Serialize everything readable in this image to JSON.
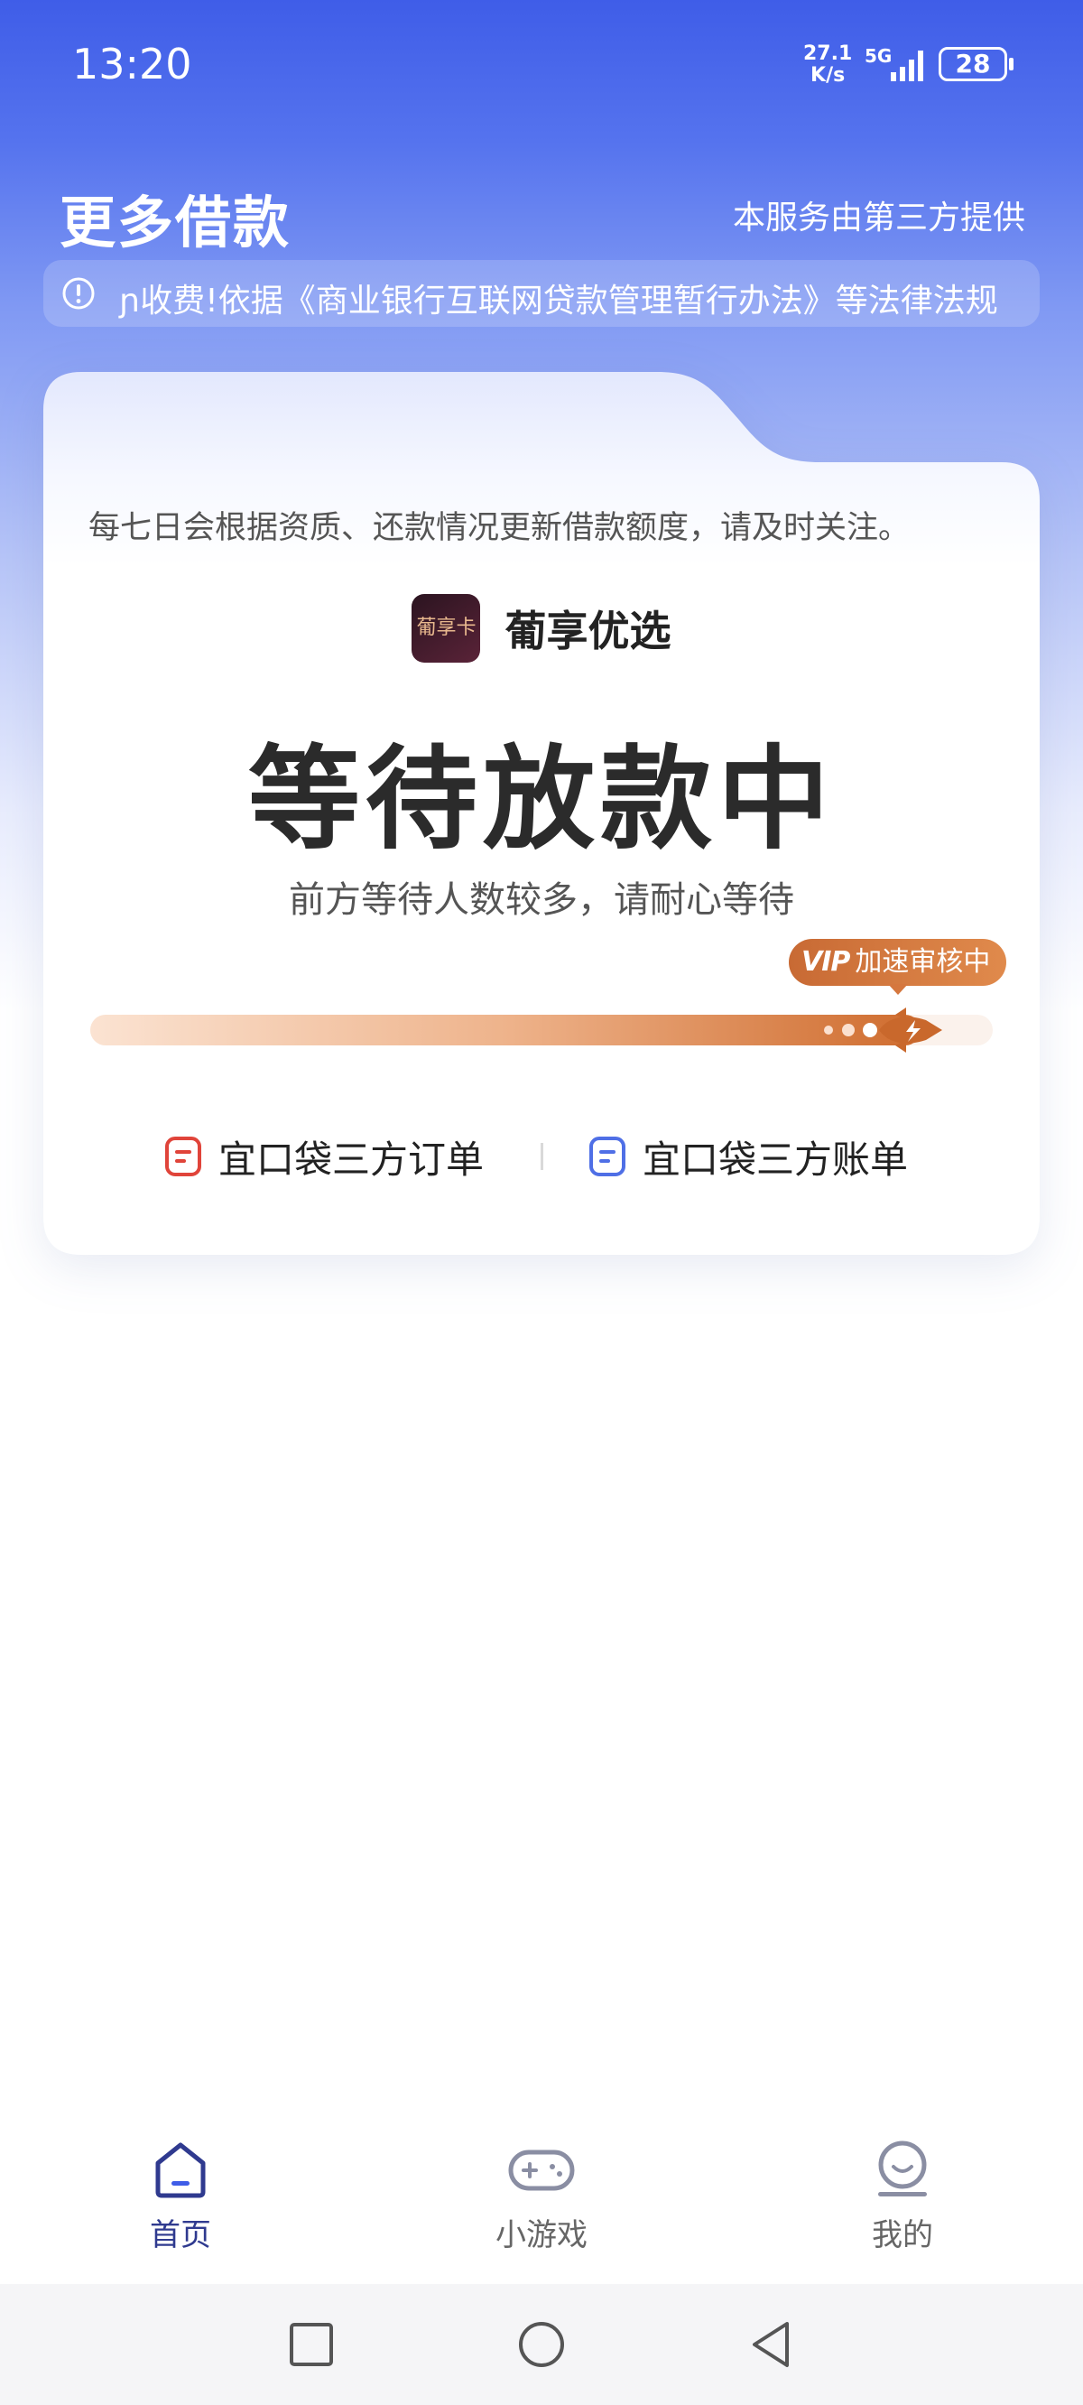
{
  "status_bar": {
    "time": "13:20",
    "net_speed_value": "27.1",
    "net_speed_unit": "K/s",
    "network": "5G",
    "battery": "28"
  },
  "header": {
    "title": "更多借款",
    "provider_note": "本服务由第三方提供"
  },
  "notice": {
    "text": "费!依据《商业银行互联网贷款管理暂行办法》等法律法规",
    "partial_glyph": "ɲ收"
  },
  "card": {
    "description": "每七日会根据资质、还款情况更新借款额度，请及时关注。",
    "brand_logo_text": "葡享卡",
    "brand_name": "葡享优选",
    "status_title": "等待放款中",
    "status_subtitle": "前方等待人数较多，请耐心等待",
    "vip_mark": "VIP",
    "vip_text": "加速审核中",
    "progress": 0.92,
    "links": [
      {
        "label": "宜口袋三方订单",
        "icon": "order-doc-icon",
        "color": "#e0443a"
      },
      {
        "label": "宜口袋三方账单",
        "icon": "bill-doc-icon",
        "color": "#4f6fe6"
      }
    ]
  },
  "bottom_nav": {
    "items": [
      {
        "label": "首页",
        "icon": "home-icon",
        "active": true
      },
      {
        "label": "小游戏",
        "icon": "gamepad-icon",
        "active": false
      },
      {
        "label": "我的",
        "icon": "profile-icon",
        "active": false
      }
    ]
  },
  "colors": {
    "primary": "#3f5de8",
    "nav_active": "#2f3a8f",
    "nav_inactive": "#8a8ea3",
    "vip": "#d5773e"
  }
}
